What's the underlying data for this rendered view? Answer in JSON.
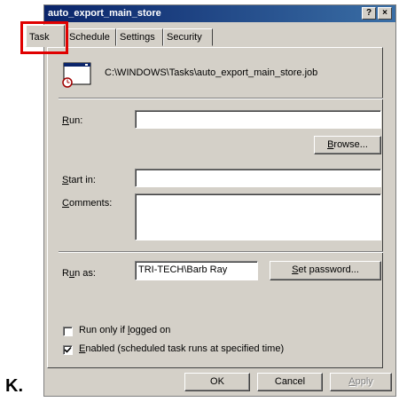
{
  "window": {
    "title": "auto_export_main_store",
    "help_button": "?",
    "close_button": "×"
  },
  "tabs": [
    {
      "label": "Task",
      "active": true
    },
    {
      "label": "Schedule",
      "active": false
    },
    {
      "label": "Settings",
      "active": false
    },
    {
      "label": "Security",
      "active": false
    }
  ],
  "task": {
    "path": "C:\\WINDOWS\\Tasks\\auto_export_main_store.job",
    "run_label_key": "R",
    "run_label_rest": "un:",
    "run_value": "",
    "browse_key": "B",
    "browse_rest": "rowse...",
    "start_in_key": "S",
    "start_in_rest": "tart in:",
    "start_in_value": "",
    "comments_key": "C",
    "comments_rest": "omments:",
    "comments_value": "",
    "run_as_pre": "R",
    "run_as_key": "u",
    "run_as_rest": "n as:",
    "run_as_value": "TRI-TECH\\Barb Ray",
    "set_password_key": "S",
    "set_password_rest": "et password...",
    "run_only_pre": "Run only if ",
    "run_only_key": "l",
    "run_only_rest": "ogged on",
    "run_only_checked": false,
    "enabled_key": "E",
    "enabled_rest": "nabled (scheduled task runs at specified time)",
    "enabled_checked": true
  },
  "buttons": {
    "ok": "OK",
    "cancel": "Cancel",
    "apply_key": "A",
    "apply_rest": "pply"
  },
  "side_label": "K."
}
